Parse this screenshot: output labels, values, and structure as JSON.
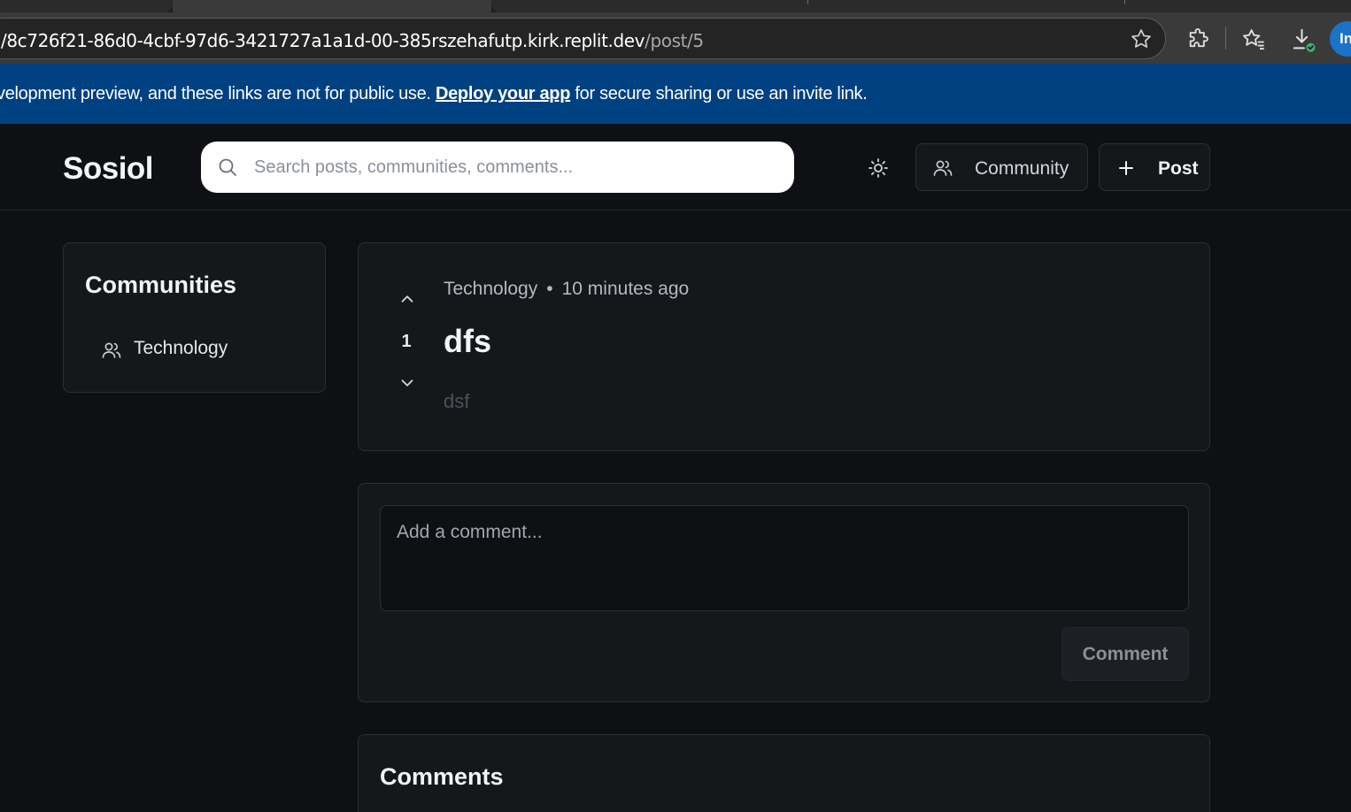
{
  "browser": {
    "url_host": "/8c726f21-86d0-4cbf-97d6-3421727a1a1d-00-385rszehafutp.kirk.replit.dev",
    "url_path": "/post/5",
    "profile_initial": "In"
  },
  "banner": {
    "text_before": "velopment preview, and these links are not for public use. ",
    "link_text": "Deploy your app",
    "text_after": " for secure sharing or use an invite link."
  },
  "header": {
    "logo": "Sosiol",
    "search_placeholder": "Search posts, communities, comments...",
    "community_button": "Community",
    "post_button": "Post"
  },
  "sidebar": {
    "title": "Communities",
    "items": [
      {
        "label": "Technology",
        "icon": "users-icon"
      }
    ]
  },
  "post": {
    "community": "Technology",
    "separator": "•",
    "time": "10 minutes ago",
    "votes": "1",
    "title": "dfs",
    "body": "dsf"
  },
  "comment_form": {
    "placeholder": "Add a comment...",
    "submit_label": "Comment"
  },
  "comments": {
    "title": "Comments"
  },
  "colors": {
    "background": "#0e1014",
    "card": "#15171b",
    "banner": "#004182",
    "border": "#2a2e36"
  }
}
